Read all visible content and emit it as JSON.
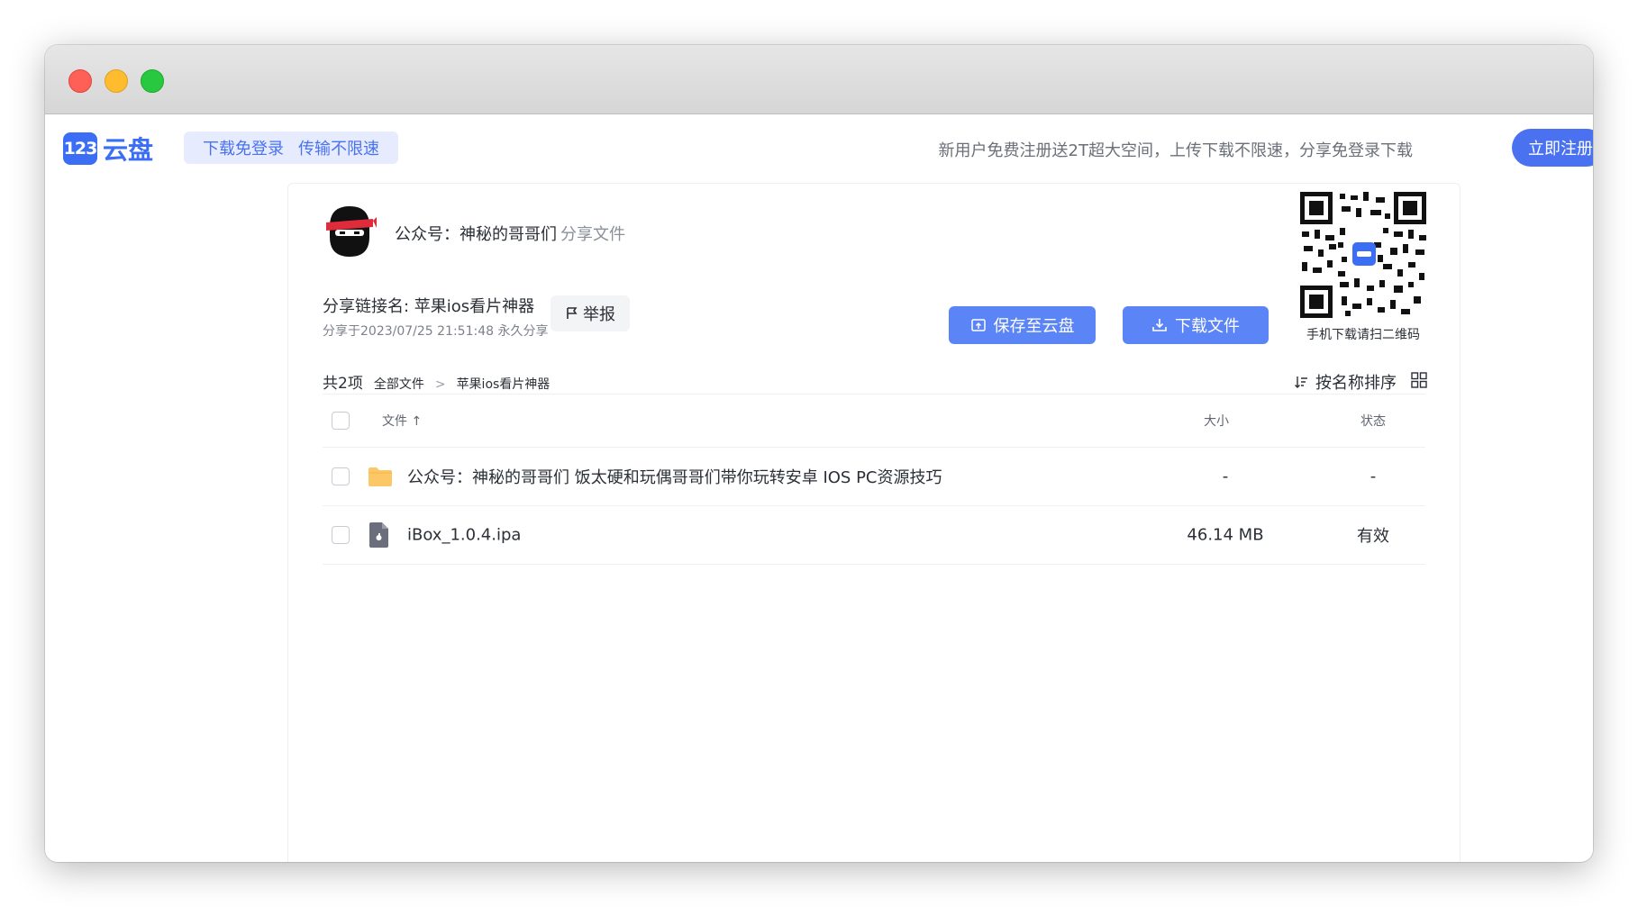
{
  "header": {
    "logo_mark": "123",
    "logo_text": "云盘",
    "promo": [
      "下载免登录",
      "传输不限速"
    ],
    "notice": "新用户免费注册送2T超大空间，上传下载不限速，分享免登录下载",
    "register_label": "立即注册"
  },
  "share": {
    "sharer_name": "公众号：神秘的哥哥们",
    "sharer_suffix": "分享文件",
    "link_name": "分享链接名: 苹果ios看片神器",
    "meta": "分享于2023/07/25 21:51:48 永久分享",
    "report_label": "举报",
    "save_label": "保存至云盘",
    "download_label": "下载文件",
    "qr_caption": "手机下载请扫二维码"
  },
  "listing": {
    "count": "共2项",
    "crumbs": [
      "全部文件",
      "苹果ios看片神器"
    ],
    "crumb_sep": ">",
    "sort_label": "按名称排序",
    "columns": {
      "name": "文件 ↑",
      "size": "大小",
      "status": "状态"
    },
    "rows": [
      {
        "icon": "folder-icon",
        "name": "公众号：神秘的哥哥们 饭太硬和玩偶哥哥们带你玩转安卓 IOS PC资源技巧",
        "size": "-",
        "status": "-"
      },
      {
        "icon": "ipa-file-icon",
        "name": "iBox_1.0.4.ipa",
        "size": "46.14 MB",
        "status": "有效"
      }
    ]
  },
  "colors": {
    "accent": "#4a72f0",
    "button": "#5b84f6",
    "folder": "#fcc867"
  }
}
